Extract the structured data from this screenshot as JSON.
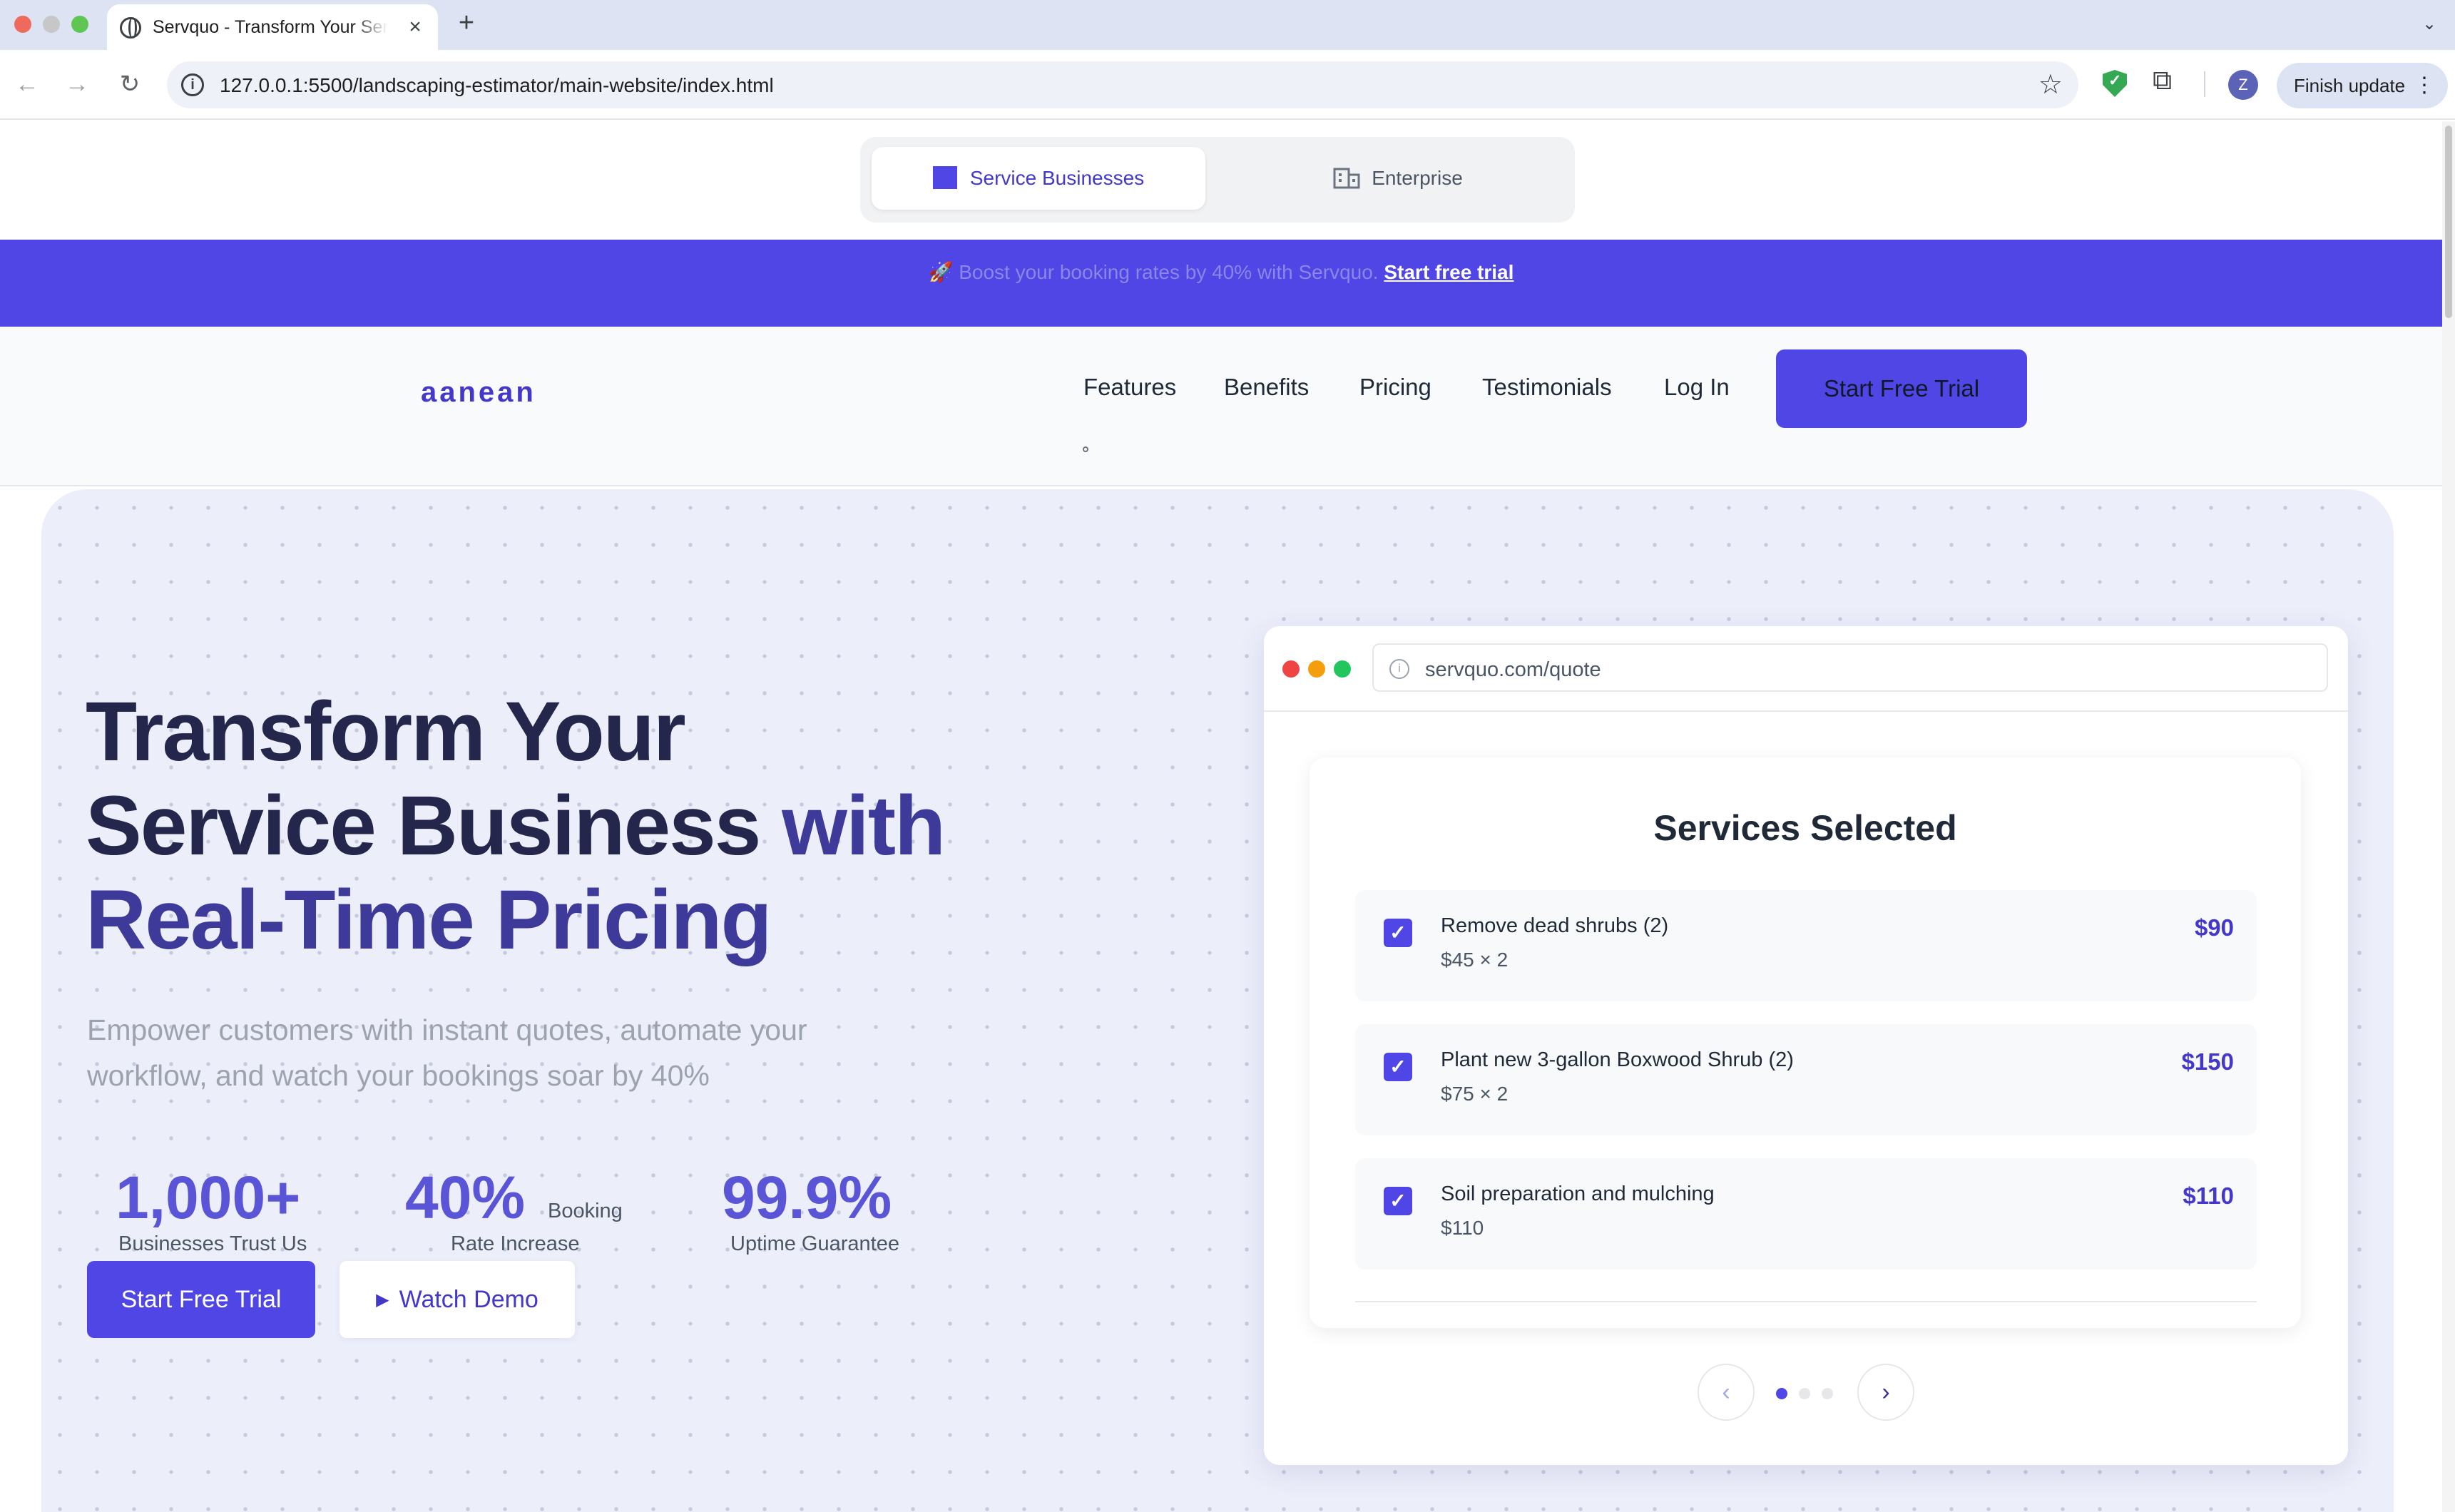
{
  "browser": {
    "tab_title": "Servquo - Transform Your Service Business",
    "url": "127.0.0.1:5500/landscaping-estimator/main-website/index.html",
    "finish_update": "Finish update",
    "avatar_letter": "Z"
  },
  "audience_switch": {
    "business": "Service Businesses",
    "enterprise": "Enterprise"
  },
  "banner": {
    "emoji": "🚀",
    "text": "Boost your booking rates by 40% with Servquo.",
    "link": "Start free trial"
  },
  "nav": {
    "logo": "aanean",
    "links": [
      "Features",
      "Benefits",
      "Pricing",
      "Testimonials",
      "Log In"
    ],
    "cta": "Start Free Trial"
  },
  "hero": {
    "title_line1": "Transform Your",
    "title_line2_a": "Service Business ",
    "title_line2_b": "with",
    "title_line3": "Real-Time Pricing",
    "subtitle": "Empower customers with instant quotes, automate your workflow, and watch your bookings soar by 40%",
    "stats": [
      {
        "value": "1,000+",
        "label": "Businesses Trust Us"
      },
      {
        "value": "40%",
        "label_inline": "Booking",
        "label": "Rate Increase"
      },
      {
        "value": "99.9%",
        "label": "Uptime Guarantee"
      }
    ],
    "cta_primary": "Start Free Trial",
    "cta_secondary": "Watch Demo"
  },
  "mock_browser": {
    "url": "servquo.com/quote",
    "card_title": "Services Selected",
    "services": [
      {
        "name": "Remove dead shrubs (2)",
        "detail": "$45 × 2",
        "price": "$90",
        "checked": true
      },
      {
        "name": "Plant new 3-gallon Boxwood Shrub (2)",
        "detail": "$75 × 2",
        "price": "$150",
        "checked": true
      },
      {
        "name": "Soil preparation and mulching",
        "detail": "$110",
        "price": "$110",
        "checked": true
      }
    ],
    "carousel": {
      "active_index": 0,
      "count": 3
    }
  },
  "colors": {
    "brand": "#4f46e5",
    "brand_dark": "#4338ca",
    "title_dark": "#24264b",
    "hero_bg": "#eceefa"
  }
}
